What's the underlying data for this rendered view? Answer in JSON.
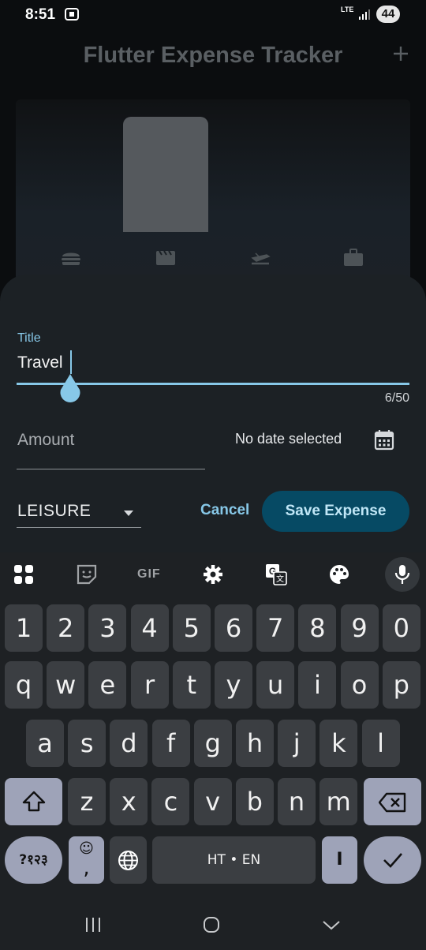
{
  "status": {
    "time": "8:51",
    "network": "LTE",
    "battery": "44"
  },
  "appbar": {
    "title": "Flutter Expense Tracker"
  },
  "chart_icons": [
    "food-icon",
    "movie-icon",
    "flight-icon",
    "work-icon"
  ],
  "form": {
    "title_label": "Title",
    "title_value": "Travel",
    "counter": "6/50",
    "amount_label": "Amount",
    "date_text": "No date selected",
    "category_value": "LEISURE",
    "cancel_label": "Cancel",
    "save_label": "Save Expense"
  },
  "keyboard": {
    "gif_label": "GIF",
    "row1": [
      "1",
      "2",
      "3",
      "4",
      "5",
      "6",
      "7",
      "8",
      "9",
      "0"
    ],
    "row2": [
      "q",
      "w",
      "e",
      "r",
      "t",
      "y",
      "u",
      "i",
      "o",
      "p"
    ],
    "row3": [
      "a",
      "s",
      "d",
      "f",
      "g",
      "h",
      "j",
      "k",
      "l"
    ],
    "row4": [
      "z",
      "x",
      "c",
      "v",
      "b",
      "n",
      "m"
    ],
    "symbols_label": "?१२३",
    "emoji_label": "☺",
    "comma_label": ",",
    "space_label": "HT • EN",
    "period_label": "I"
  },
  "colors": {
    "accent": "#87c8e8",
    "save_bg": "#064a64",
    "sheet_bg": "#1c2125"
  }
}
